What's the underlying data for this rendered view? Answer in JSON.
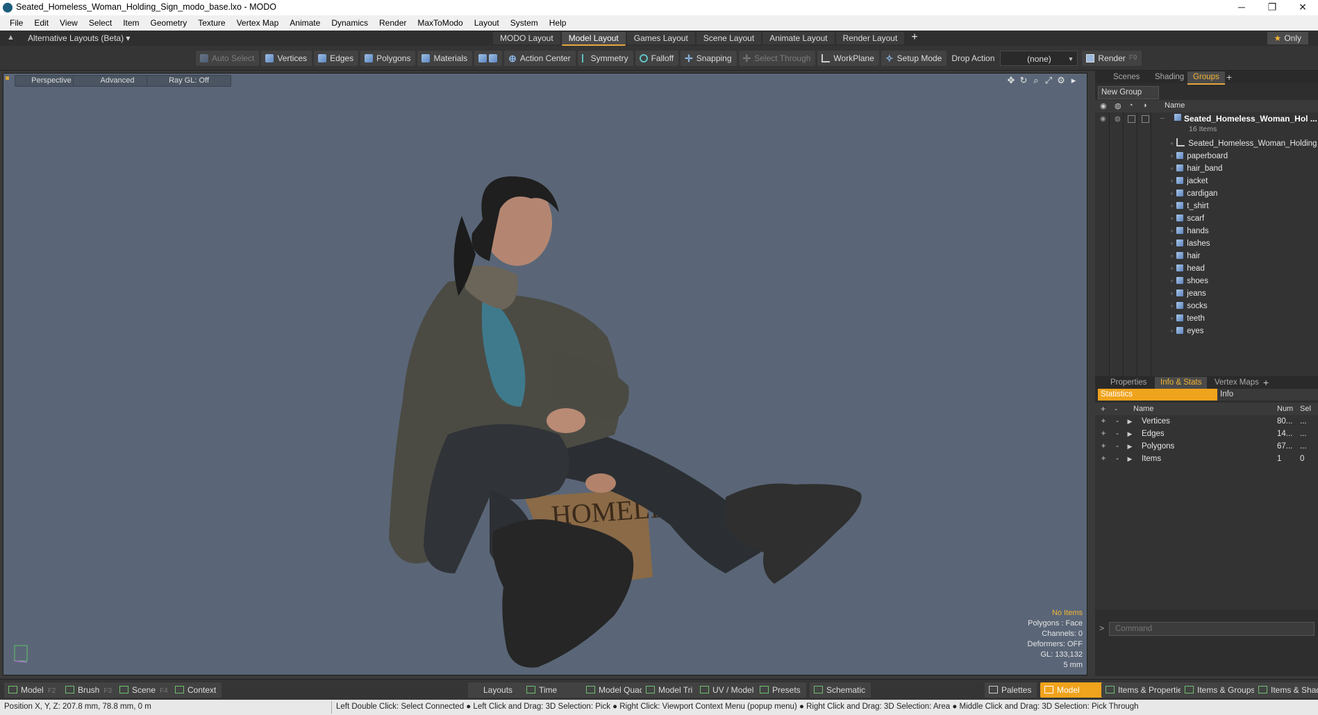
{
  "window": {
    "title": "Seated_Homeless_Woman_Holding_Sign_modo_base.lxo - MODO",
    "controls": [
      "─",
      "❐",
      "✕"
    ]
  },
  "menu": [
    "File",
    "Edit",
    "View",
    "Select",
    "Item",
    "Geometry",
    "Texture",
    "Vertex Map",
    "Animate",
    "Dynamics",
    "Render",
    "MaxToModo",
    "Layout",
    "System",
    "Help"
  ],
  "layout_bar": {
    "alternative_layouts": "Alternative Layouts (Beta) ▾",
    "tabs": [
      "MODO Layout",
      "Model Layout",
      "Games Layout",
      "Scene Layout",
      "Animate Layout",
      "Render Layout"
    ],
    "active_tab": "Model Layout",
    "add": "+",
    "only": "Only"
  },
  "toolbar": {
    "auto_select": "Auto Select",
    "vertices": "Vertices",
    "edges": "Edges",
    "polygons": "Polygons",
    "materials": "Materials",
    "action_center": "Action Center",
    "symmetry": "Symmetry",
    "falloff": "Falloff",
    "snapping": "Snapping",
    "select_through": "Select Through",
    "workplane": "WorkPlane",
    "setup_mode": "Setup Mode",
    "drop_action_label": "Drop Action",
    "drop_action_value": "(none)",
    "render": "Render",
    "render_key": "F9"
  },
  "viewport": {
    "tabs": [
      "Perspective",
      "Advanced",
      "Ray GL: Off"
    ],
    "icons": [
      "move-icon",
      "rotate-icon",
      "zoom-icon",
      "maximize-icon",
      "settings-icon",
      "play-icon"
    ],
    "hud": {
      "no_items": "No Items",
      "polygons": "Polygons : Face",
      "channels": "Channels: 0",
      "deformers": "Deformers: OFF",
      "gl": "GL: 133,132",
      "scale": "5 mm"
    },
    "sign_text": "HOMELESS"
  },
  "right_panel": {
    "top_tabs": [
      "Scenes",
      "Shading",
      "Groups"
    ],
    "active_top_tab": "Groups",
    "new_group": "New Group",
    "name_header": "Name",
    "root_group": "Seated_Homeless_Woman_Hol ...",
    "root_count": "16 Items",
    "items": [
      "Seated_Homeless_Woman_Holding ...",
      "paperboard",
      "hair_band",
      "jacket",
      "cardigan",
      "t_shirt",
      "scarf",
      "hands",
      "lashes",
      "hair",
      "head",
      "shoes",
      "jeans",
      "socks",
      "teeth",
      "eyes"
    ],
    "bottom_tabs": [
      "Properties",
      "Info & Stats",
      "Vertex Maps"
    ],
    "active_bottom_tab": "Info & Stats",
    "statistics_tab": "Statistics",
    "info_tab": "Info",
    "stats_columns": {
      "name": "Name",
      "num": "Num",
      "sel": "Sel"
    },
    "stats": [
      {
        "name": "Vertices",
        "num": "80...",
        "sel": "..."
      },
      {
        "name": "Edges",
        "num": "14...",
        "sel": "..."
      },
      {
        "name": "Polygons",
        "num": "67...",
        "sel": "..."
      },
      {
        "name": "Items",
        "num": "1",
        "sel": "0"
      }
    ],
    "command_placeholder": "Command"
  },
  "bottom_bar": {
    "left": [
      {
        "label": "Model",
        "key": "F2"
      },
      {
        "label": "Brush",
        "key": "F3"
      },
      {
        "label": "Scene",
        "key": "F4"
      },
      {
        "label": "Context",
        "key": ""
      }
    ],
    "center": [
      "Layouts",
      "Time",
      "Model Quad",
      "Model Tri",
      "UV / Model",
      "Presets",
      "Schematic"
    ],
    "right": [
      "Palettes",
      "Model",
      "Items & Properties",
      "Items & Groups",
      "Items & Shading"
    ]
  },
  "status": {
    "position": "Position X, Y, Z:   207.8 mm, 78.8 mm, 0 m",
    "hints": "Left Double Click: Select Connected ● Left Click and Drag: 3D Selection: Pick ● Right Click: Viewport Context Menu (popup menu) ● Right Click and Drag: 3D Selection: Area ● Middle Click and Drag: 3D Selection: Pick Through"
  },
  "colors": {
    "accent": "#f0a31c",
    "viewport_bg": "#5a6677",
    "panel_bg": "#2e2e2e"
  }
}
